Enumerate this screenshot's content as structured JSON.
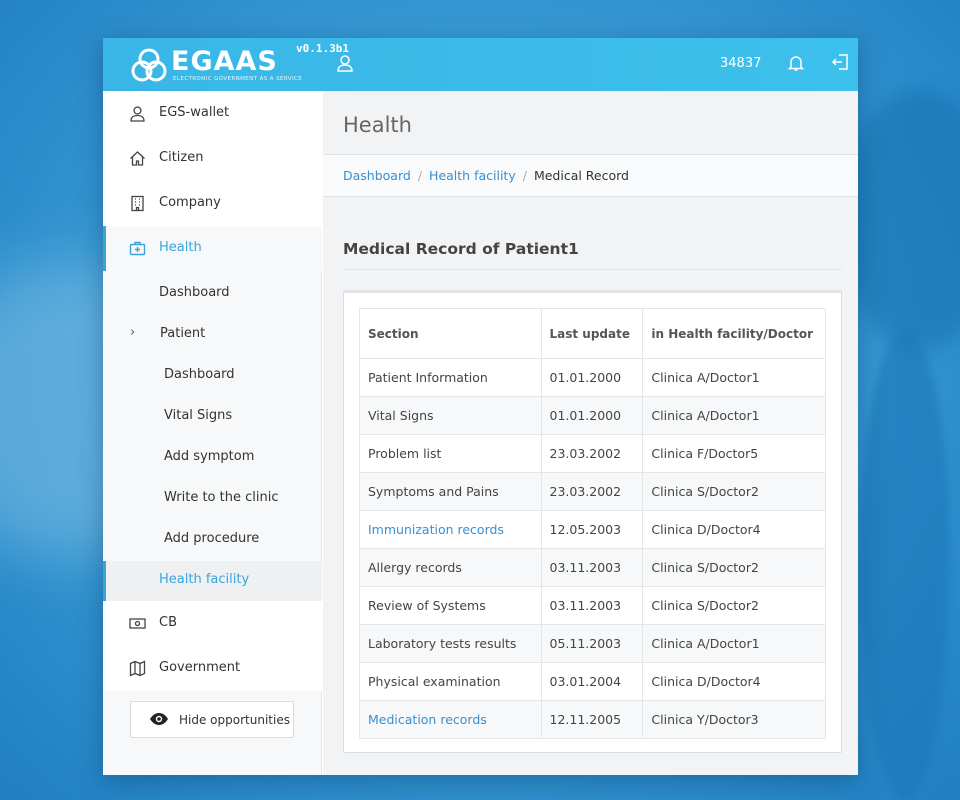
{
  "app": {
    "logo_text": "EGAAS",
    "logo_subtitle": "ELECTRONIC GOVERNMENT AS A SERVICE",
    "version": "v0.1.3b1",
    "balance": "34837"
  },
  "sidebar": {
    "items": [
      {
        "label": "EGS-wallet",
        "icon": "user-icon"
      },
      {
        "label": "Citizen",
        "icon": "home-icon"
      },
      {
        "label": "Company",
        "icon": "building-icon"
      },
      {
        "label": "Health",
        "icon": "medkit-icon"
      },
      {
        "label": "CB",
        "icon": "money-icon"
      },
      {
        "label": "Government",
        "icon": "map-icon"
      }
    ],
    "health_sub": {
      "dashboard": "Dashboard",
      "patient": "Patient",
      "patient_sub": [
        "Dashboard",
        "Vital Signs",
        "Add symptom",
        "Write to the clinic",
        "Add procedure"
      ],
      "health_facility": "Health facility"
    },
    "hide_button": "Hide opportunities"
  },
  "main": {
    "page_title": "Health",
    "breadcrumb": [
      "Dashboard",
      "Health facility",
      "Medical Record"
    ],
    "section_title": "Medical Record of Patient1",
    "table": {
      "headers": [
        "Section",
        "Last update",
        "in Health facility/Doctor"
      ],
      "rows": [
        {
          "section": "Patient Information",
          "date": "01.01.2000",
          "doctor": "Clinica A/Doctor1"
        },
        {
          "section": "Vital Signs",
          "date": "01.01.2000",
          "doctor": "Clinica A/Doctor1"
        },
        {
          "section": "Problem list",
          "date": "23.03.2002",
          "doctor": "Clinica F/Doctor5"
        },
        {
          "section": "Symptoms and Pains",
          "date": "23.03.2002",
          "doctor": "Clinica S/Doctor2"
        },
        {
          "section": "Immunization records",
          "date": "12.05.2003",
          "doctor": "Clinica D/Doctor4"
        },
        {
          "section": "Allergy records",
          "date": "03.11.2003",
          "doctor": "Clinica S/Doctor2"
        },
        {
          "section": "Review of Systems",
          "date": "03.11.2003",
          "doctor": "Clinica S/Doctor2"
        },
        {
          "section": "Laboratory tests results",
          "date": "05.11.2003",
          "doctor": "Clinica A/Doctor1"
        },
        {
          "section": "Physical examination",
          "date": "03.01.2004",
          "doctor": "Clinica D/Doctor4"
        },
        {
          "section": "Medication records",
          "date": "12.11.2005",
          "doctor": "Clinica Y/Doctor3"
        }
      ]
    }
  },
  "colors": {
    "accent": "#3aa3d8",
    "topbar": "#3cbbea",
    "link": "#3a8fcf"
  }
}
